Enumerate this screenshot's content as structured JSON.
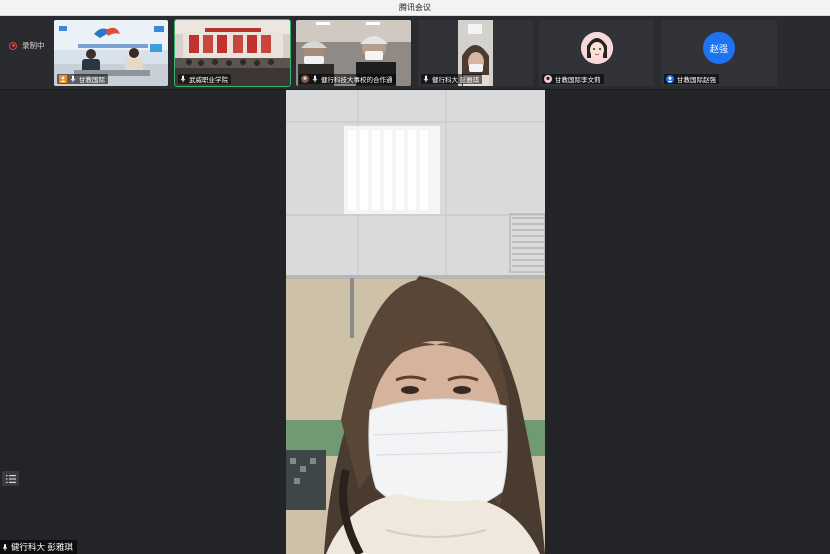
{
  "window": {
    "title": "腾讯会议"
  },
  "recording": {
    "label": "录制中"
  },
  "participants": [
    {
      "name": "甘教国际",
      "icon": "user-orange-icon"
    },
    {
      "name": "武威职业学院",
      "icon": "mic-icon",
      "speaking": true
    },
    {
      "name": "健行科技大事校的合作通",
      "icon": "mic-icon"
    },
    {
      "name": "健行科大 彭雅琪",
      "icon": "mic-icon"
    },
    {
      "name": "甘教国际李文莉",
      "icon": "avatar-icon"
    },
    {
      "name": "甘教国际赵强",
      "icon": "avatar-icon",
      "avatar_text": "赵强"
    }
  ],
  "main_video": {
    "name": "健行科大 彭雅琪"
  },
  "colors": {
    "accent_blue": "#1e74f0",
    "record_red": "#e8433a",
    "speaking_green": "#35b36a"
  }
}
